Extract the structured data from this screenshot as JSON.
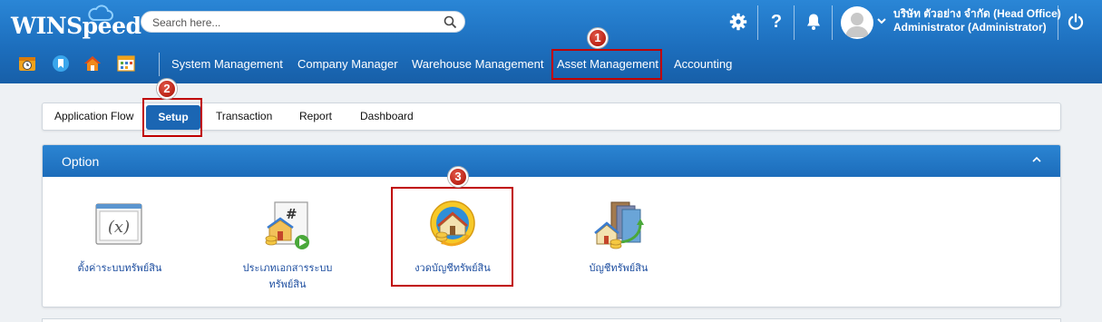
{
  "header": {
    "logo_text": "WINSpeed",
    "search": {
      "placeholder": "Search here..."
    },
    "icons": [
      "settings-icon",
      "help-icon",
      "bell-icon"
    ],
    "user": {
      "company": "บริษัท ตัวอย่าง จำกัด (Head Office)",
      "name": "Administrator (Administrator)"
    }
  },
  "quick_icons": [
    "clock-icon",
    "bookmark-icon",
    "home-icon",
    "calendar-icon"
  ],
  "menu": [
    {
      "label": "System Management"
    },
    {
      "label": "Company Manager"
    },
    {
      "label": "Warehouse Management"
    },
    {
      "label": "Asset Management",
      "highlighted": true
    },
    {
      "label": "Accounting"
    }
  ],
  "tabs": [
    {
      "label": "Application Flow"
    },
    {
      "label": "Setup",
      "active": true
    },
    {
      "label": "Transaction"
    },
    {
      "label": "Report"
    },
    {
      "label": "Dashboard"
    }
  ],
  "panel": {
    "title": "Option",
    "items": [
      {
        "label": "ตั้งค่าระบบทรัพย์สิน",
        "icon": "function-settings-icon"
      },
      {
        "label_line1": "ประเภทเอกสารระบบ",
        "label_line2": "ทรัพย์สิน",
        "icon": "document-type-icon"
      },
      {
        "label": "งวดบัญชีทรัพย์สิน",
        "icon": "accounting-period-icon",
        "highlighted": true
      },
      {
        "label": "บัญชีทรัพย์สิน",
        "icon": "asset-account-icon"
      }
    ]
  },
  "annotations": {
    "step1": "1",
    "step2": "2",
    "step3": "3"
  },
  "colors": {
    "header": "#1d6fbe",
    "active_tab": "#1b66b3",
    "highlight": "#c00000",
    "link": "#1f4fa0"
  }
}
